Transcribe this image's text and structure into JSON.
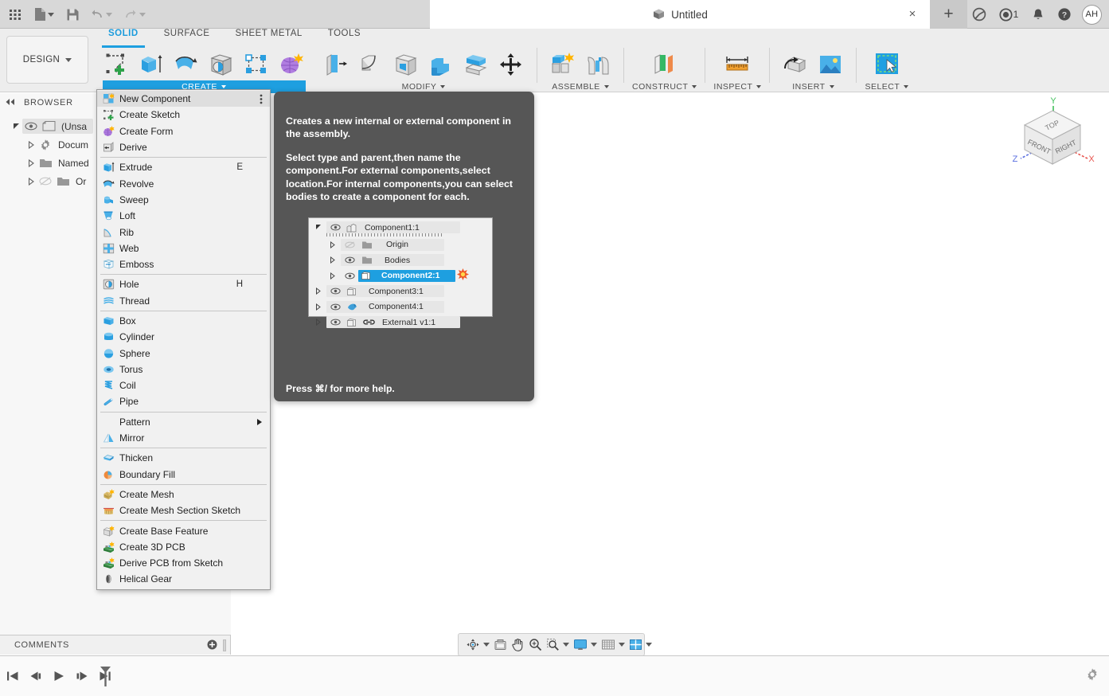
{
  "titlebar": {
    "grid_icon": "apps-grid-icon",
    "file_icon": "new-file-icon",
    "save_icon": "save-icon",
    "undo_icon": "undo-icon",
    "redo_icon": "redo-icon",
    "document_title": "Untitled",
    "document_icon": "cube-icon",
    "close_tab": "×",
    "new_tab": "+",
    "help_icon": "help-icon",
    "bell_icon": "notifications-icon",
    "jobs_icon": "job-status-icon",
    "jobs_count": "1",
    "extension_icon": "extension-icon",
    "avatar_initials": "AH"
  },
  "ribbon": {
    "workspace": "DESIGN",
    "tabs": [
      {
        "label": "SOLID",
        "active": true
      },
      {
        "label": "SURFACE",
        "active": false
      },
      {
        "label": "SHEET METAL",
        "active": false
      },
      {
        "label": "TOOLS",
        "active": false
      }
    ],
    "groups": [
      {
        "label": "CREATE",
        "active": true,
        "icons": [
          "create-sketch-icon",
          "extrude-icon",
          "revolve-icon",
          "hole-icon",
          "pattern-icon",
          "create-form-icon"
        ]
      },
      {
        "label": "MODIFY",
        "active": false,
        "icons": [
          "press-pull-icon",
          "fillet-icon",
          "shell-icon",
          "combine-icon",
          "offset-face-icon",
          "move-copy-icon"
        ]
      },
      {
        "label": "ASSEMBLE",
        "active": false,
        "icons": [
          "new-component-icon",
          "joint-icon"
        ]
      },
      {
        "label": "CONSTRUCT",
        "active": false,
        "icons": [
          "offset-plane-icon"
        ]
      },
      {
        "label": "INSPECT",
        "active": false,
        "icons": [
          "measure-icon"
        ]
      },
      {
        "label": "INSERT",
        "active": false,
        "icons": [
          "insert-derive-icon",
          "insert-image-icon"
        ]
      },
      {
        "label": "SELECT",
        "active": false,
        "icons": [
          "select-window-icon"
        ]
      }
    ]
  },
  "browser": {
    "title": "BROWSER",
    "collapse_icon": "collapse-panel-icon",
    "items": [
      {
        "label": "(Unsa",
        "icon": "document-icon",
        "indent": 0,
        "expanded": true,
        "eye": "visible",
        "selected": true
      },
      {
        "label": "Docum",
        "icon": "settings-gear-icon",
        "indent": 1,
        "expanded": false,
        "eye": "none",
        "selected": false
      },
      {
        "label": "Named",
        "icon": "folder-icon",
        "indent": 1,
        "expanded": false,
        "eye": "none",
        "selected": false
      },
      {
        "label": "Or",
        "icon": "folder-icon",
        "indent": 1,
        "expanded": false,
        "eye": "hidden",
        "selected": false
      }
    ]
  },
  "create_menu": {
    "items": [
      {
        "label": "New Component",
        "icon": "new-component-icon",
        "shortcut": "",
        "highlighted": true,
        "kebab": true
      },
      {
        "label": "Create Sketch",
        "icon": "create-sketch-icon",
        "shortcut": ""
      },
      {
        "label": "Create Form",
        "icon": "create-form-icon",
        "shortcut": ""
      },
      {
        "label": "Derive",
        "icon": "derive-icon",
        "shortcut": ""
      },
      {
        "separator": true
      },
      {
        "label": "Extrude",
        "icon": "extrude-icon",
        "shortcut": "E"
      },
      {
        "label": "Revolve",
        "icon": "revolve-icon",
        "shortcut": ""
      },
      {
        "label": "Sweep",
        "icon": "sweep-icon",
        "shortcut": ""
      },
      {
        "label": "Loft",
        "icon": "loft-icon",
        "shortcut": ""
      },
      {
        "label": "Rib",
        "icon": "rib-icon",
        "shortcut": ""
      },
      {
        "label": "Web",
        "icon": "web-icon",
        "shortcut": ""
      },
      {
        "label": "Emboss",
        "icon": "emboss-icon",
        "shortcut": ""
      },
      {
        "separator": true
      },
      {
        "label": "Hole",
        "icon": "hole-icon",
        "shortcut": "H"
      },
      {
        "label": "Thread",
        "icon": "thread-icon",
        "shortcut": ""
      },
      {
        "separator": true
      },
      {
        "label": "Box",
        "icon": "box-icon",
        "shortcut": ""
      },
      {
        "label": "Cylinder",
        "icon": "cylinder-icon",
        "shortcut": ""
      },
      {
        "label": "Sphere",
        "icon": "sphere-icon",
        "shortcut": ""
      },
      {
        "label": "Torus",
        "icon": "torus-icon",
        "shortcut": ""
      },
      {
        "label": "Coil",
        "icon": "coil-icon",
        "shortcut": ""
      },
      {
        "label": "Pipe",
        "icon": "pipe-icon",
        "shortcut": ""
      },
      {
        "separator": true
      },
      {
        "label": "Pattern",
        "icon": "",
        "shortcut": "",
        "submenu": true
      },
      {
        "label": "Mirror",
        "icon": "mirror-icon",
        "shortcut": ""
      },
      {
        "separator": true
      },
      {
        "label": "Thicken",
        "icon": "thicken-icon",
        "shortcut": ""
      },
      {
        "label": "Boundary Fill",
        "icon": "boundary-fill-icon",
        "shortcut": ""
      },
      {
        "separator": true
      },
      {
        "label": "Create Mesh",
        "icon": "create-mesh-icon",
        "shortcut": ""
      },
      {
        "label": "Create Mesh Section Sketch",
        "icon": "mesh-section-sketch-icon",
        "shortcut": ""
      },
      {
        "separator": true
      },
      {
        "label": "Create Base Feature",
        "icon": "base-feature-icon",
        "shortcut": ""
      },
      {
        "label": "Create 3D PCB",
        "icon": "pcb-3d-icon",
        "shortcut": ""
      },
      {
        "label": "Derive PCB from Sketch",
        "icon": "derive-pcb-icon",
        "shortcut": ""
      },
      {
        "label": "Helical Gear",
        "icon": "helical-gear-icon",
        "shortcut": ""
      }
    ]
  },
  "tooltip": {
    "paragraph1": "Creates a new internal or external component in the assembly.",
    "paragraph2": "Select type and parent,then name the component.For external components,select location.For internal components,you can select bodies to create a component for each.",
    "footer": "Press ⌘/ for more help.",
    "tree": [
      {
        "label": "Component1:1",
        "icon": "component-root-icon",
        "indent": 0,
        "expanded": true,
        "eye": "visible",
        "selected": false,
        "hatched": true
      },
      {
        "label": "Origin",
        "icon": "folder-icon",
        "indent": 1,
        "expanded": false,
        "eye": "hidden",
        "selected": false
      },
      {
        "label": "Bodies",
        "icon": "folder-icon",
        "indent": 1,
        "expanded": false,
        "eye": "visible",
        "selected": false
      },
      {
        "label": "Component2:1",
        "icon": "component-icon",
        "indent": 1,
        "expanded": false,
        "eye": "visible",
        "selected": true,
        "starburst": true
      },
      {
        "label": "Component3:1",
        "icon": "component-icon",
        "indent": 0,
        "expanded": false,
        "eye": "visible",
        "selected": false
      },
      {
        "label": "Component4:1",
        "icon": "joint-icon",
        "indent": 0,
        "expanded": false,
        "eye": "visible",
        "selected": false
      },
      {
        "label": "External1 v1:1",
        "icon": "component-icon",
        "indent": 0,
        "expanded": false,
        "eye": "visible",
        "selected": false,
        "link": true
      }
    ]
  },
  "viewcube": {
    "top_face": "TOP",
    "front_face": "FRONT",
    "right_face": "RIGHT",
    "axis_x": "X",
    "axis_y": "Y",
    "axis_z": "Z",
    "color_x": "#e8554f",
    "color_y": "#3fbf5a",
    "color_z": "#5a6fe0"
  },
  "comments": {
    "label": "COMMENTS",
    "add_icon": "add-comment-icon"
  },
  "navbar": {
    "buttons": [
      {
        "icon": "orbit-icon",
        "caret": true
      },
      {
        "icon": "look-at-icon",
        "caret": false
      },
      {
        "icon": "pan-icon",
        "caret": false
      },
      {
        "icon": "zoom-icon",
        "caret": false
      },
      {
        "icon": "zoom-window-icon",
        "caret": true
      },
      {
        "icon": "display-settings-icon",
        "caret": true
      },
      {
        "icon": "grid-snap-icon",
        "caret": true
      },
      {
        "icon": "viewports-icon",
        "caret": true
      }
    ]
  },
  "timeline": {
    "buttons": [
      {
        "icon": "go-to-beginning-icon"
      },
      {
        "icon": "step-back-icon"
      },
      {
        "icon": "play-icon"
      },
      {
        "icon": "step-forward-icon"
      },
      {
        "icon": "go-to-end-icon"
      }
    ],
    "marker_icon": "timeline-marker-icon",
    "settings_icon": "timeline-settings-icon"
  },
  "colors": {
    "accent": "#1e9fe0",
    "titlebar_bg": "#d8d8d8",
    "ribbon_bg": "#ededed",
    "tooltip_bg": "#565656",
    "menu_bg": "#f1f1f1"
  }
}
